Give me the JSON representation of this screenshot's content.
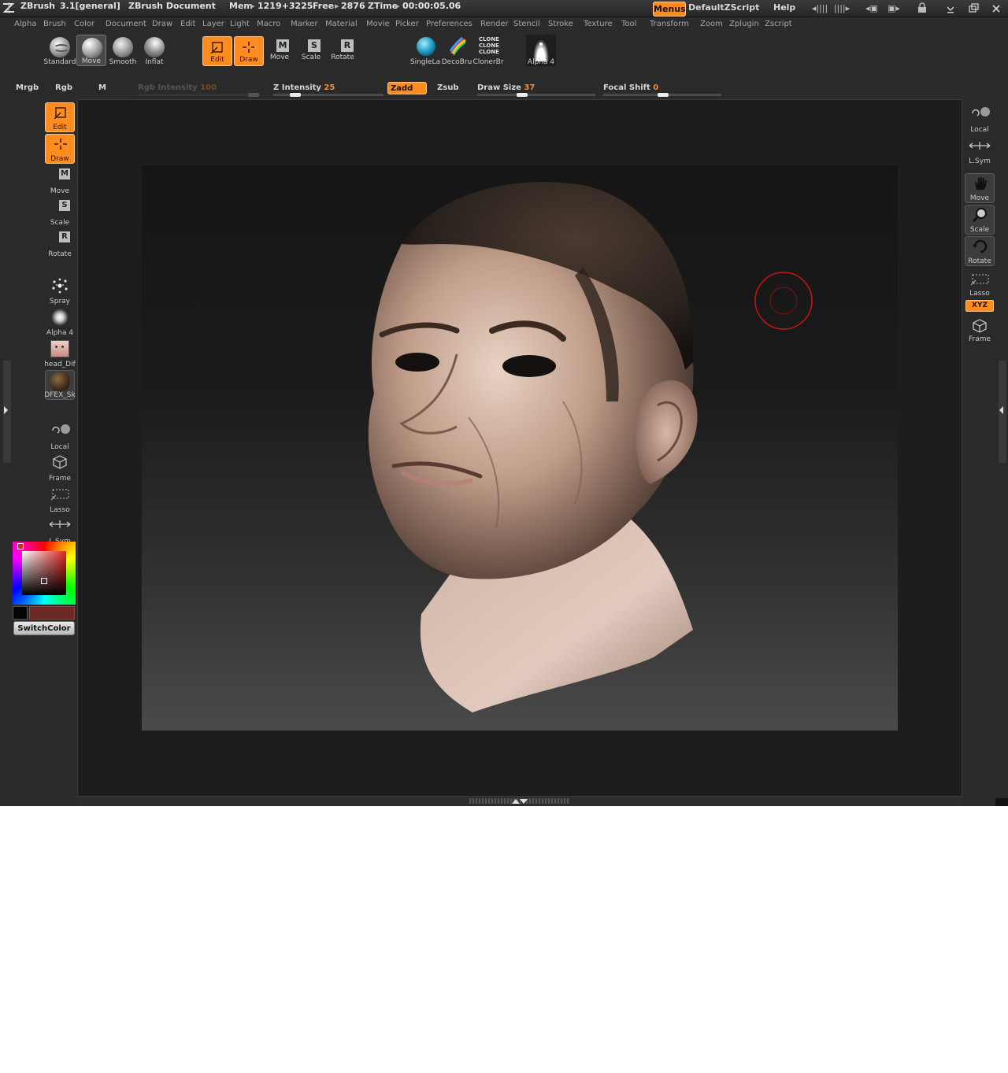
{
  "titlebar": {
    "app": "ZBrush",
    "version": "3.1[general]",
    "document": "ZBrush Document",
    "mem_label": "Mem",
    "mem_value": "1219+3225",
    "free_label": "Free",
    "free_value": "2876",
    "ztime_label": "ZTime",
    "ztime_value": "00:00:05.06",
    "menus_button": "Menus",
    "zscript": "DefaultZScript",
    "help": "Help"
  },
  "menu": [
    "Alpha",
    "Brush",
    "Color",
    "Document",
    "Draw",
    "Edit",
    "Layer",
    "Light",
    "Macro",
    "Marker",
    "Material",
    "Movie",
    "Picker",
    "Preferences",
    "Render",
    "Stencil",
    "Stroke",
    "Texture",
    "Tool",
    "Transform",
    "Zoom",
    "Zplugin",
    "Zscript"
  ],
  "brushes": [
    {
      "label": "Standard"
    },
    {
      "label": "Move"
    },
    {
      "label": "Smooth"
    },
    {
      "label": "Inflat"
    }
  ],
  "transform_tools": [
    {
      "label": "Edit",
      "glyph": ""
    },
    {
      "label": "Draw",
      "glyph": ""
    },
    {
      "label": "Move",
      "glyph": "M"
    },
    {
      "label": "Scale",
      "glyph": "S"
    },
    {
      "label": "Rotate",
      "glyph": "R"
    }
  ],
  "stroke_tools": [
    {
      "label": "SingleLa"
    },
    {
      "label": "DecoBru"
    },
    {
      "label": "ClonerBr",
      "glyph_lines": [
        "CLONE",
        "CLONE",
        "CLONE"
      ]
    }
  ],
  "alpha_top": {
    "label": "Alpha 4"
  },
  "sliders": {
    "mrgb": "Mrgb",
    "rgb": "Rgb",
    "m": "M",
    "rgb_intensity_label": "Rgb  Intensity",
    "rgb_intensity_value": "100",
    "z_intensity_label": "Z  Intensity",
    "z_intensity_value": "25",
    "zadd": "Zadd",
    "zsub": "Zsub",
    "draw_size_label": "Draw  Size",
    "draw_size_value": "37",
    "focal_shift_label": "Focal  Shift",
    "focal_shift_value": "0"
  },
  "left_shelf": {
    "edit": "Edit",
    "draw": "Draw",
    "move": "Move",
    "move_glyph": "M",
    "scale": "Scale",
    "scale_glyph": "S",
    "rotate": "Rotate",
    "rotate_glyph": "R",
    "spray": "Spray",
    "alpha": "Alpha 4",
    "texture": "head_Dif",
    "material": "DFEX_Sk",
    "local": "Local",
    "frame": "Frame",
    "lasso": "Lasso",
    "lsym": "L.Sym",
    "switch_color": "SwitchColor"
  },
  "right_shelf": {
    "local": "Local",
    "lsym": "L.Sym",
    "move": "Move",
    "scale": "Scale",
    "rotate": "Rotate",
    "lasso": "Lasso",
    "xyz": "XYZ",
    "frame": "Frame"
  },
  "colors": {
    "accent": "#ff8c1f",
    "main_color": "#6b2a26",
    "secondary_color": "#050505",
    "cursor_ring": "#c81414"
  }
}
